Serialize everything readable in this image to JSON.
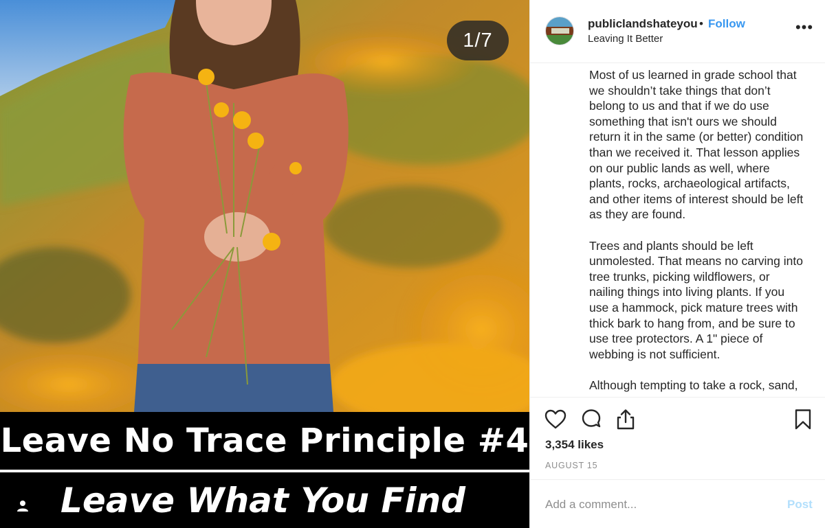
{
  "post": {
    "counter": "1/7",
    "image_caption_line1": "Leave No Trace Principle #4",
    "image_caption_line2": "Leave What You Find"
  },
  "header": {
    "username": "publiclandshateyou",
    "separator": "•",
    "follow_label": "Follow",
    "location": "Leaving It Better",
    "more_label": "•••"
  },
  "caption": {
    "paragraphs": [
      "Most of us learned in grade school that we shouldn’t take things that don’t belong to us and that if we do use something that isn't ours we should return it in the same (or better) condition than we received it. That lesson applies on our public lands as well, where plants, rocks, archaeological artifacts, and other items of interest should be left as they are found.",
      "Trees and plants should be left unmolested. That means no carving into tree trunks, picking wildflowers, or nailing things into living plants. If you use a hammock, pick mature trees with thick bark to hang from, and be sure to use tree protectors. A 1\" piece of webbing is not sufficient.",
      "Although tempting to take a rock, sand,"
    ]
  },
  "actions": {
    "likes": "3,354 likes",
    "date": "AUGUST 15",
    "icons": [
      "heart-icon",
      "comment-icon",
      "share-icon",
      "bookmark-icon"
    ]
  },
  "comment_box": {
    "placeholder": "Add a comment...",
    "post_label": "Post"
  },
  "colors": {
    "accent": "#3897f0",
    "post_disabled": "#b2dffc",
    "secondary_text": "#8e8e8e"
  }
}
